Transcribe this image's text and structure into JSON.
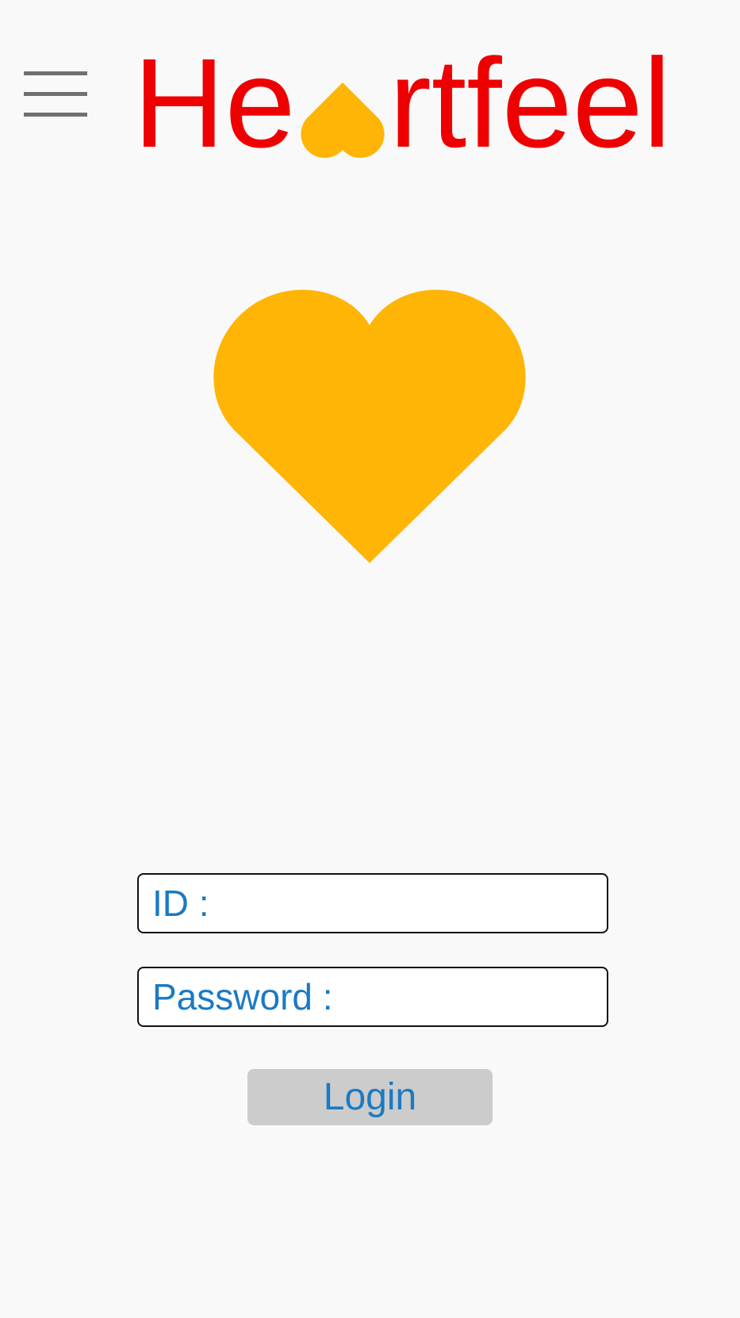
{
  "header": {
    "menu_icon": "hamburger-menu-icon",
    "logo": {
      "text_before": "He",
      "heart_icon": "heart-icon",
      "text_after": "rtfeel",
      "color": "#ee0000",
      "heart_color": "#ffb506"
    }
  },
  "hero": {
    "icon": "heart-icon",
    "color": "#ffb506"
  },
  "form": {
    "id_label": "ID : ",
    "id_value": "",
    "password_label": "Password : ",
    "password_value": "",
    "login_label": "Login",
    "label_color": "#1a7ac4",
    "button_color": "#cccccc"
  }
}
